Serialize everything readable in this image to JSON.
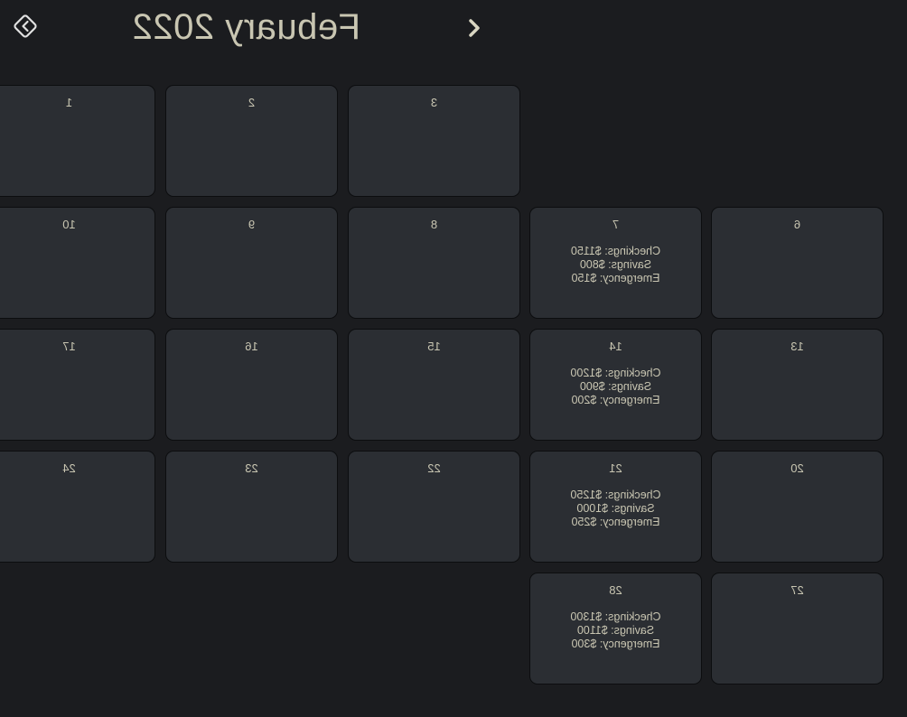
{
  "header": {
    "title": "Febuary 2022",
    "prev_icon": "chevron-left-icon",
    "next_icon": "diamond-arrow-right-icon"
  },
  "colors": {
    "background": "#1b1c1f",
    "cell": "#2b2e33",
    "text": "#c9c6b2"
  },
  "calendar": {
    "days": [
      {
        "day": "1"
      },
      {
        "day": "2"
      },
      {
        "day": "3"
      },
      {
        "day": "6"
      },
      {
        "day": "7",
        "entries": [
          "Checkings: $1150",
          "Savings: $800",
          "Emergency: $150"
        ]
      },
      {
        "day": "8"
      },
      {
        "day": "9"
      },
      {
        "day": "10"
      },
      {
        "day": "13"
      },
      {
        "day": "14",
        "entries": [
          "Checkings: $1200",
          "Savings: $900",
          "Emergency: $200"
        ]
      },
      {
        "day": "15"
      },
      {
        "day": "16"
      },
      {
        "day": "17"
      },
      {
        "day": "20"
      },
      {
        "day": "21",
        "entries": [
          "Checkings: $1250",
          "Savings: $1000",
          "Emergency: $250"
        ]
      },
      {
        "day": "22"
      },
      {
        "day": "23"
      },
      {
        "day": "24"
      },
      {
        "day": "27"
      },
      {
        "day": "28",
        "entries": [
          "Checkings: $1300",
          "Savings: $1100",
          "Emergency: $300"
        ]
      }
    ]
  }
}
